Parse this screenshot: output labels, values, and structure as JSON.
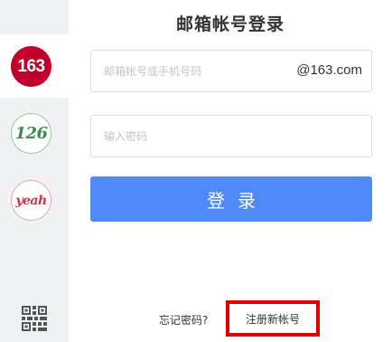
{
  "title": "邮箱帐号登录",
  "brands": [
    {
      "label": "163",
      "color": "#c1002b",
      "active": true
    },
    {
      "label": "126",
      "color": "#3d8a56",
      "active": false
    },
    {
      "label": "yeah",
      "color": "#d5304f",
      "active": false
    }
  ],
  "sidebar": {
    "qr_icon": "qr-code-icon"
  },
  "account": {
    "placeholder": "邮箱帐号或手机号码",
    "value": "",
    "domain_suffix": "@163.com"
  },
  "password": {
    "placeholder": "输入密码",
    "value": ""
  },
  "login_button": {
    "label": "登录",
    "color": "#4f8af8"
  },
  "footer": {
    "forgot_label": "忘记密码?",
    "register_label": "注册新帐号",
    "highlight_color": "#e10000"
  }
}
